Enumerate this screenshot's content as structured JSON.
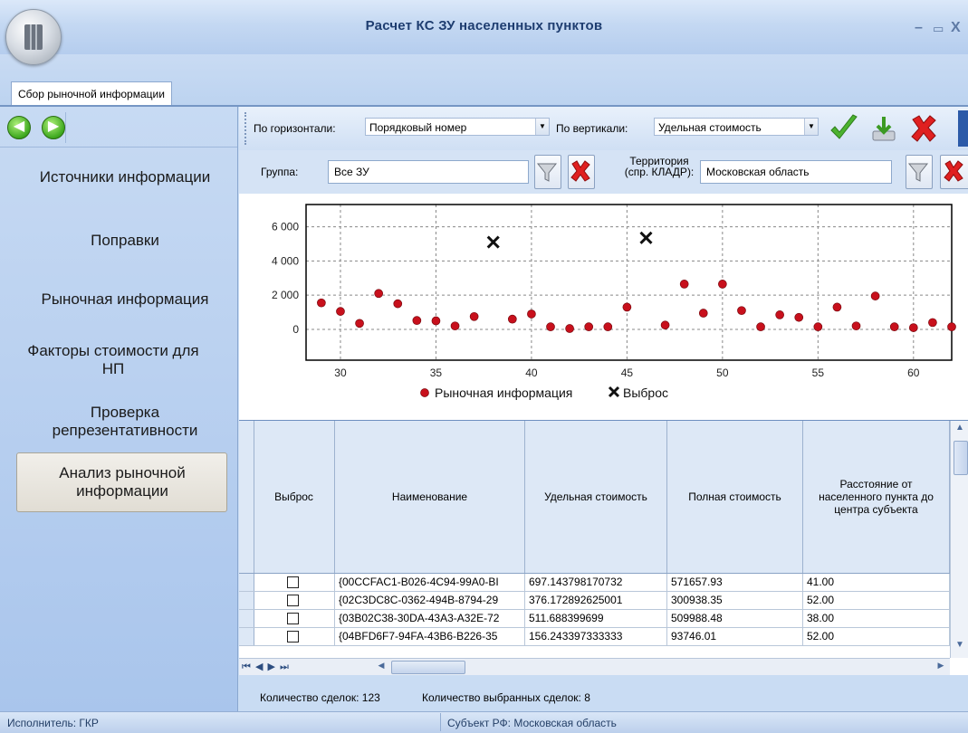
{
  "window": {
    "title": "Расчет КС ЗУ населенных пунктов",
    "minimize_glyph": "–",
    "maximize_glyph": "▭",
    "close_glyph": "X"
  },
  "tabs": [
    {
      "label": "Сбор рыночной информации",
      "active": true
    }
  ],
  "nav": {
    "back_icon": "arrow-left-icon",
    "forward_icon": "arrow-right-icon",
    "items": [
      {
        "label": "Источники информации"
      },
      {
        "label": "Поправки"
      },
      {
        "label": "Рыночная информация"
      },
      {
        "label": "Факторы стоимости для НП"
      },
      {
        "label": "Проверка репрезентативности"
      },
      {
        "label": "Анализ рыночной информации",
        "selected": true
      }
    ]
  },
  "toolbar": {
    "horizontal_label": "По горизонтали:",
    "horizontal_value": "Порядковый номер",
    "vertical_label": "По вертикали:",
    "vertical_value": "Удельная стоимость",
    "icons": [
      "checkmark-icon",
      "download-icon",
      "delete-icon"
    ]
  },
  "filters": {
    "group_label": "Группа:",
    "group_value": "Все ЗУ",
    "territory_label_1": "Территория",
    "territory_label_2": "(спр. КЛАДР):",
    "territory_value": "Московская область",
    "filter_icon": "funnel-icon",
    "clear_icon": "red-x-icon"
  },
  "chart_data": {
    "type": "scatter",
    "xlim": [
      28.2,
      62
    ],
    "ylim": [
      -1800,
      7300
    ],
    "xticks": [
      "30",
      "35",
      "40",
      "45",
      "50",
      "55",
      "60"
    ],
    "yticks": [
      "0",
      "2 000",
      "4 000",
      "6 000"
    ],
    "grid": true,
    "legend_position": "bottom",
    "colors": {
      "market": "#c8101c",
      "outlier": "#111111",
      "grid": "#888888"
    },
    "series": [
      {
        "name": "Рыночная информация",
        "marker": "circle",
        "x": [
          28,
          29,
          30,
          31,
          32,
          33,
          34,
          35,
          36,
          37,
          39,
          40,
          41,
          42,
          43,
          44,
          45,
          47,
          48,
          49,
          50,
          51,
          52,
          53,
          54,
          55,
          56,
          57,
          58,
          59,
          60,
          61,
          62
        ],
        "y": [
          650,
          1550,
          1050,
          350,
          2100,
          1500,
          520,
          500,
          200,
          750,
          600,
          900,
          150,
          50,
          150,
          150,
          1300,
          250,
          2650,
          950,
          2650,
          1100,
          150,
          850,
          700,
          150,
          1300,
          200,
          1950,
          150,
          100,
          400,
          150
        ]
      },
      {
        "name": "Выброс",
        "marker": "cross",
        "x": [
          38,
          46
        ],
        "y": [
          5100,
          5350
        ]
      }
    ]
  },
  "grid": {
    "columns": [
      "Выброс",
      "Наименование",
      "Удельная стоимость",
      "Полная стоимость",
      "Расстояние от населенного пункта до центра субъекта"
    ],
    "rows": [
      {
        "outlier": false,
        "name": "{00CCFAC1-B026-4C94-99A0-BI",
        "unit_cost": "697.143798170732",
        "full_cost": "571657.93",
        "distance": "41.00"
      },
      {
        "outlier": false,
        "name": "{02C3DC8C-0362-494B-8794-29",
        "unit_cost": "376.172892625001",
        "full_cost": "300938.35",
        "distance": "52.00"
      },
      {
        "outlier": false,
        "name": "{03B02C38-30DA-43A3-A32E-72",
        "unit_cost": "511.688399699",
        "full_cost": "509988.48",
        "distance": "38.00"
      },
      {
        "outlier": false,
        "name": "{04BFD6F7-94FA-43B6-B226-35",
        "unit_cost": "156.243397333333",
        "full_cost": "93746.01",
        "distance": "52.00"
      }
    ],
    "nav_glyphs": "⏮ ◀ ▶ ⏭"
  },
  "summary": {
    "deals_count": "Количество сделок: 123",
    "selected_count": "Количество выбранных сделок: 8"
  },
  "statusbar": {
    "executor": "Исполнитель: ГКР",
    "subject": "Субъект РФ: Московская область"
  }
}
